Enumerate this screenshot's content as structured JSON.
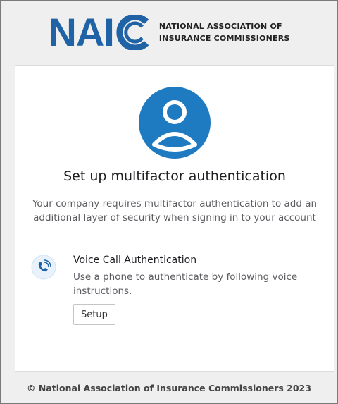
{
  "brand": {
    "logo_text": "NAIC",
    "tagline_line1": "NATIONAL ASSOCIATION OF",
    "tagline_line2": "INSURANCE COMMISSIONERS",
    "color": "#1f63a6"
  },
  "card": {
    "avatar_icon": "user-avatar-icon",
    "title": "Set up multifactor authentication",
    "description": "Your company requires multifactor authentication to add an additional layer of security when signing in to your account",
    "factor": {
      "icon": "phone-call-icon",
      "name": "Voice Call Authentication",
      "description": "Use a phone to authenticate by following voice instructions.",
      "button_label": "Setup"
    }
  },
  "footer": {
    "copyright": "© National Association of Insurance Commissioners 2023"
  },
  "colors": {
    "accent": "#1f7bc1",
    "background": "#efefef"
  }
}
